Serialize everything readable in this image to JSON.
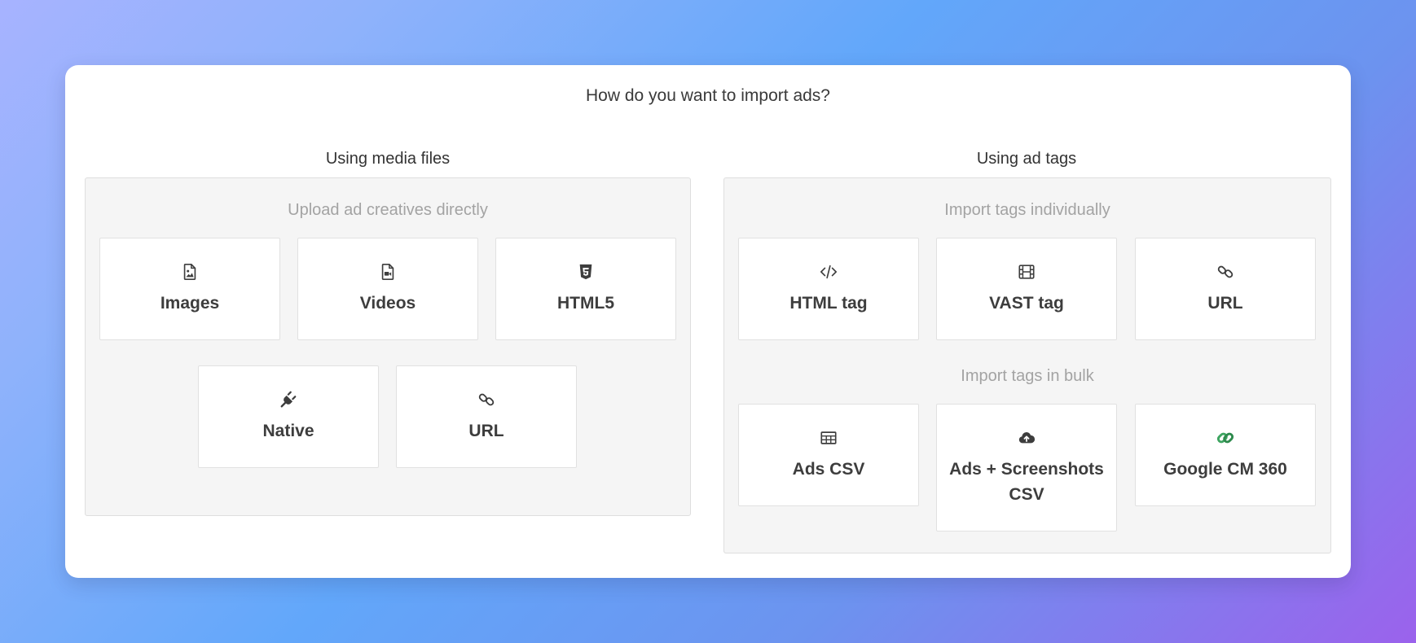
{
  "heading": "How do you want to import ads?",
  "media": {
    "title": "Using media files",
    "subtitle": "Upload ad creatives directly",
    "options": [
      {
        "label": "Images",
        "icon": "image-file-icon"
      },
      {
        "label": "Videos",
        "icon": "video-file-icon"
      },
      {
        "label": "HTML5",
        "icon": "html5-icon"
      },
      {
        "label": "Native",
        "icon": "plug-icon"
      },
      {
        "label": "URL",
        "icon": "link-icon"
      }
    ]
  },
  "tags": {
    "title": "Using ad tags",
    "individual_subtitle": "Import tags individually",
    "individual": [
      {
        "label": "HTML tag",
        "icon": "code-icon"
      },
      {
        "label": "VAST tag",
        "icon": "film-icon"
      },
      {
        "label": "URL",
        "icon": "link-icon"
      }
    ],
    "bulk_subtitle": "Import tags in bulk",
    "bulk": [
      {
        "label": "Ads CSV",
        "icon": "table-icon"
      },
      {
        "label": "Ads + Screenshots CSV",
        "icon": "cloud-upload-icon"
      },
      {
        "label": "Google CM 360",
        "icon": "google-cm360-icon"
      }
    ]
  },
  "colors": {
    "icon": "#3d3d3d",
    "google_green": "#3ea561",
    "google_green_dark": "#2e8a4d"
  }
}
